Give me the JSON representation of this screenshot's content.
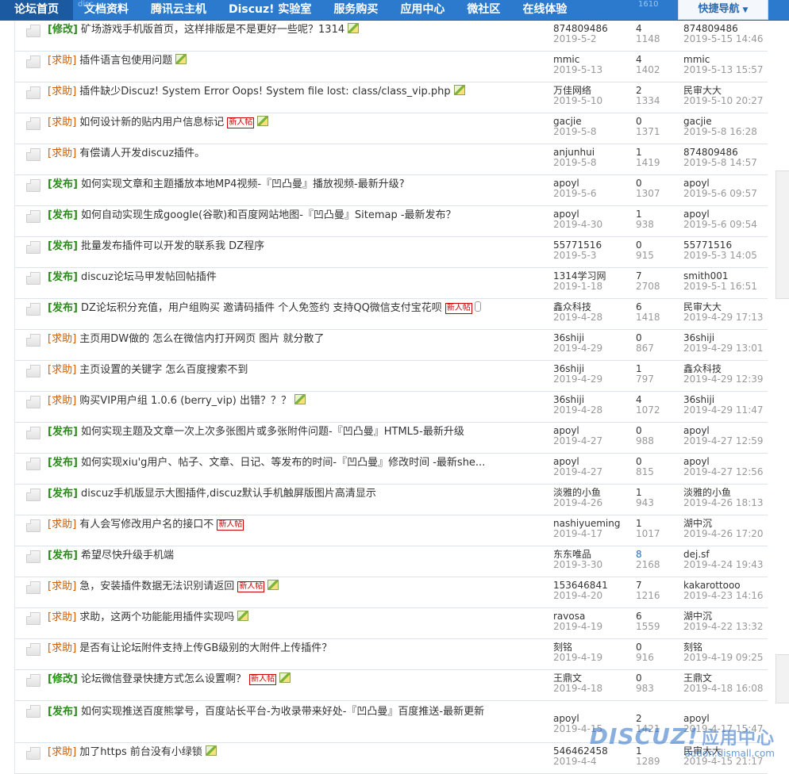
{
  "nav": {
    "items": [
      {
        "label": "论坛首页",
        "active": true
      },
      {
        "label": "文档资料"
      },
      {
        "label": "腾讯云主机"
      },
      {
        "label": "Discuz! 实验室"
      },
      {
        "label": "服务购买"
      },
      {
        "label": "应用中心"
      },
      {
        "label": "微社区"
      },
      {
        "label": "在线体验"
      }
    ],
    "quick": "快捷导航"
  },
  "ghost_text": {
    "left": "disc",
    "right": "1610"
  },
  "threads": [
    {
      "type": "[修改]",
      "kind": "xiugai",
      "title": "矿场游戏手机版首页，这样排版是不是更好一些呢？1314",
      "img": true,
      "author": "874809486",
      "date": "2019-5-2",
      "replies": "4",
      "views": "1148",
      "last_user": "874809486",
      "last_time": "2019-5-15 14:46"
    },
    {
      "type": "[求助]",
      "kind": "qiuzhu",
      "title": "插件语言包使用问题",
      "img": true,
      "author": "mmic",
      "date": "2019-5-13",
      "replies": "4",
      "views": "1402",
      "last_user": "mmic",
      "last_time": "2019-5-13 15:57"
    },
    {
      "type": "[求助]",
      "kind": "qiuzhu",
      "title": "插件缺少Discuz! System Error Oops! System file lost: class/class_vip.php",
      "img": true,
      "author": "万佳网络",
      "date": "2019-5-10",
      "replies": "2",
      "views": "1334",
      "last_user": "民审大大",
      "last_time": "2019-5-10 20:27"
    },
    {
      "type": "[求助]",
      "kind": "qiuzhu",
      "title": "如何设计新的贴内用户信息标记",
      "newbadge": "新人帖",
      "img": true,
      "author": "gacjie",
      "date": "2019-5-8",
      "replies": "0",
      "views": "1371",
      "last_user": "gacjie",
      "last_time": "2019-5-8 16:28"
    },
    {
      "type": "[求助]",
      "kind": "qiuzhu",
      "title": "有偿请人开发discuz插件。",
      "author": "anjunhui",
      "date": "2019-5-8",
      "replies": "1",
      "views": "1419",
      "last_user": "874809486",
      "last_time": "2019-5-8 14:57"
    },
    {
      "type": "[发布]",
      "kind": "fabu",
      "title": "如何实现文章和主题播放本地MP4视频-『凹凸曼』播放视频-最新升级?",
      "author": "apoyl",
      "date": "2019-5-6",
      "replies": "0",
      "views": "1307",
      "last_user": "apoyl",
      "last_time": "2019-5-6 09:57"
    },
    {
      "type": "[发布]",
      "kind": "fabu",
      "title": "如何自动实现生成google(谷歌)和百度网站地图-『凹凸曼』Sitemap -最新发布？",
      "author": "apoyl",
      "date": "2019-4-30",
      "replies": "1",
      "views": "938",
      "last_user": "apoyl",
      "last_time": "2019-5-6 09:54"
    },
    {
      "type": "[发布]",
      "kind": "fabu",
      "title": "批量发布插件可以开发的联系我 DZ程序",
      "author": "55771516",
      "date": "2019-5-3",
      "replies": "0",
      "views": "915",
      "last_user": "55771516",
      "last_time": "2019-5-3 14:05"
    },
    {
      "type": "[发布]",
      "kind": "fabu",
      "title": "discuz论坛马甲发帖回帖插件",
      "author": "1314学习网",
      "date": "2019-1-18",
      "replies": "7",
      "views": "2708",
      "last_user": "smith001",
      "last_time": "2019-5-1 16:51"
    },
    {
      "type": "[发布]",
      "kind": "fabu",
      "title": "DZ论坛积分充值，用户组购买 邀请码插件 个人免签约 支持QQ微信支付宝花呗",
      "newbadge": "新人帖",
      "attach": true,
      "author": "鑫众科技",
      "date": "2019-4-28",
      "replies": "6",
      "views": "1418",
      "last_user": "民审大大",
      "last_time": "2019-4-29 17:13"
    },
    {
      "type": "[求助]",
      "kind": "qiuzhu",
      "title": "主页用DW做的 怎么在微信内打开网页 图片 就分散了",
      "author": "36shiji",
      "date": "2019-4-29",
      "replies": "0",
      "views": "867",
      "last_user": "36shiji",
      "last_time": "2019-4-29 13:01"
    },
    {
      "type": "[求助]",
      "kind": "qiuzhu",
      "title": "主页设置的关键字 怎么百度搜索不到",
      "author": "36shiji",
      "date": "2019-4-29",
      "replies": "1",
      "views": "797",
      "last_user": "鑫众科技",
      "last_time": "2019-4-29 12:39"
    },
    {
      "type": "[求助]",
      "kind": "qiuzhu",
      "title": "购买VIP用户组 1.0.6 (berry_vip) 出错？？？",
      "img": true,
      "author": "36shiji",
      "date": "2019-4-28",
      "replies": "4",
      "views": "1072",
      "last_user": "36shiji",
      "last_time": "2019-4-29 11:47"
    },
    {
      "type": "[发布]",
      "kind": "fabu",
      "title": "如何实现主题及文章一次上次多张图片或多张附件问题-『凹凸曼』HTML5-最新升级",
      "author": "apoyl",
      "date": "2019-4-27",
      "replies": "0",
      "views": "988",
      "last_user": "apoyl",
      "last_time": "2019-4-27 12:59"
    },
    {
      "type": "[发布]",
      "kind": "fabu",
      "title": "如何实现xiu'g用户、帖子、文章、日记、等发布的时间-『凹凸曼』修改时间 -最新she...",
      "author": "apoyl",
      "date": "2019-4-27",
      "replies": "0",
      "views": "815",
      "last_user": "apoyl",
      "last_time": "2019-4-27 12:56"
    },
    {
      "type": "[发布]",
      "kind": "fabu",
      "title": "discuz手机版显示大图插件,discuz默认手机触屏版图片高清显示",
      "author": "淡雅的小鱼",
      "date": "2019-4-26",
      "replies": "1",
      "views": "943",
      "last_user": "淡雅的小鱼",
      "last_time": "2019-4-26 18:13"
    },
    {
      "type": "[求助]",
      "kind": "qiuzhu",
      "title": "有人会写修改用户名的接口不",
      "newbadge": "新人帖",
      "author": "nashiyueming",
      "date": "2019-4-17",
      "replies": "1",
      "views": "1017",
      "last_user": "湖中沉",
      "last_time": "2019-4-26 17:20"
    },
    {
      "type": "[发布]",
      "kind": "fabu",
      "title": "希望尽快升级手机端",
      "author": "东东唯品",
      "date": "2019-3-30",
      "replies": "8",
      "views": "2168",
      "last_user": "dej.sf",
      "last_time": "2019-4-24 19:43",
      "blue": true
    },
    {
      "type": "[求助]",
      "kind": "qiuzhu",
      "title": "急，安装插件数据无法识别请返回",
      "newbadge": "新人帖",
      "img": true,
      "author": "153646841",
      "date": "2019-4-20",
      "replies": "7",
      "views": "1216",
      "last_user": "kakarottooo",
      "last_time": "2019-4-23 14:16"
    },
    {
      "type": "[求助]",
      "kind": "qiuzhu",
      "title": "求助，这两个功能能用插件实现吗",
      "img": true,
      "author": "ravosa",
      "date": "2019-4-19",
      "replies": "6",
      "views": "1559",
      "last_user": "湖中沉",
      "last_time": "2019-4-22 13:32"
    },
    {
      "type": "[求助]",
      "kind": "qiuzhu",
      "title": "是否有让论坛附件支持上传GB级别的大附件上传插件？",
      "author": "刻铭",
      "date": "2019-4-19",
      "replies": "0",
      "views": "916",
      "last_user": "刻铭",
      "last_time": "2019-4-19 09:25"
    },
    {
      "type": "[修改]",
      "kind": "xiugai",
      "title": "论坛微信登录快捷方式怎么设置啊？",
      "newbadge": "新人帖",
      "img": true,
      "author": "王鼎文",
      "date": "2019-4-18",
      "replies": "0",
      "views": "983",
      "last_user": "王鼎文",
      "last_time": "2019-4-18 16:08"
    },
    {
      "type": "[发布]",
      "kind": "fabu",
      "title": "如何实现推送百度熊掌号，百度站长平台-为收录带来好处-『凹凸曼』百度推送-最新更新",
      "tall": true,
      "author": "apoyl",
      "date": "2019-4-15",
      "replies": "2",
      "views": "1421",
      "last_user": "apoyl",
      "last_time": "2019-4-17 15:47"
    },
    {
      "type": "[求助]",
      "kind": "qiuzhu",
      "title": "加了https 前台没有小绿锁",
      "img": true,
      "author": "546462458",
      "date": "2019-4-4",
      "replies": "1",
      "views": "1289",
      "last_user": "民审大大",
      "last_time": "2019-4-15 21:17"
    }
  ],
  "watermark": {
    "logo": "DISCUZ!",
    "logo_cn": "应用中心",
    "site": "addon.dismall.com"
  }
}
